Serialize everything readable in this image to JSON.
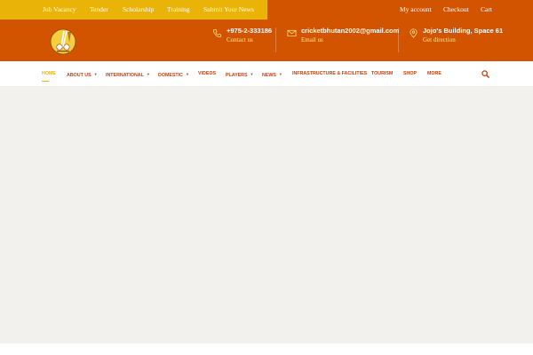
{
  "topbar": {
    "left_links": [
      "Job Vacancy",
      "Tender",
      "Scholarship",
      "Training",
      "Submit Your News"
    ],
    "right_links": [
      "My account",
      "Checkout",
      "Cart"
    ]
  },
  "header": {
    "contacts": [
      {
        "icon": "phone-icon",
        "title": "+975-2-333186",
        "subtitle": "Contact us"
      },
      {
        "icon": "email-icon",
        "title": "cricketbhutan2002@gmail.com",
        "subtitle": "Email us"
      },
      {
        "icon": "location-pin-icon",
        "title": "Jojo's Building, Space 61",
        "subtitle": "Get direction"
      }
    ]
  },
  "nav": {
    "items": [
      {
        "label": "HOME"
      },
      {
        "label": "ABOUT US"
      },
      {
        "label": "INTERNATIONAL"
      },
      {
        "label": "DOMESTIC"
      },
      {
        "label": "VIDEOS"
      },
      {
        "label": "PLAYERS"
      },
      {
        "label": "NEWS"
      },
      {
        "label": "INFRASTRUCTURE & FACILITIES"
      },
      {
        "label": "TOURISM"
      },
      {
        "label": "SHOP"
      },
      {
        "label": "MORE"
      }
    ]
  },
  "colors": {
    "brand_orange": "#d35400",
    "accent_yellow": "#eab308",
    "nav_text": "#c2410c",
    "content_bg": "#f3f1ee"
  }
}
